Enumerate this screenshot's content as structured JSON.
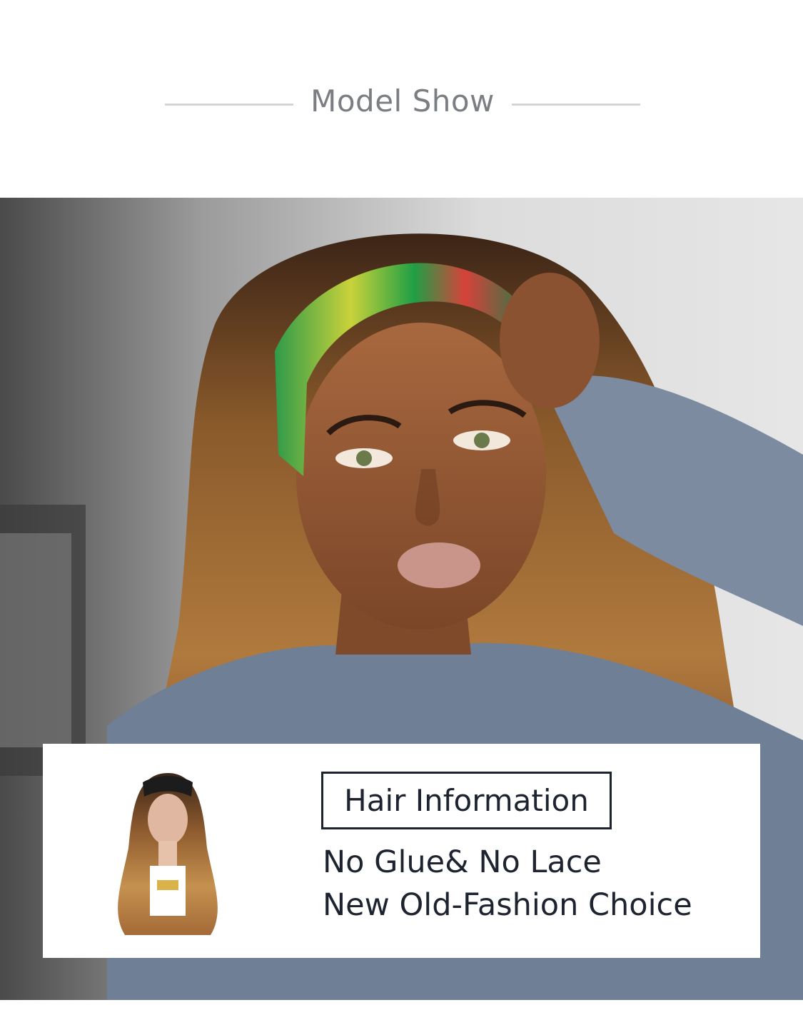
{
  "section": {
    "title": "Model Show"
  },
  "hero_image": {
    "alt": "model-photo"
  },
  "info_card": {
    "heading": "Hair Information",
    "features": [
      "No Glue& No Lace",
      "New Old-Fashion Choice"
    ]
  },
  "colors": {
    "title_gray": "#7a7d82",
    "divider": "#d4d4d4",
    "text_dark": "#1e2330",
    "card_bg": "#ffffff"
  }
}
